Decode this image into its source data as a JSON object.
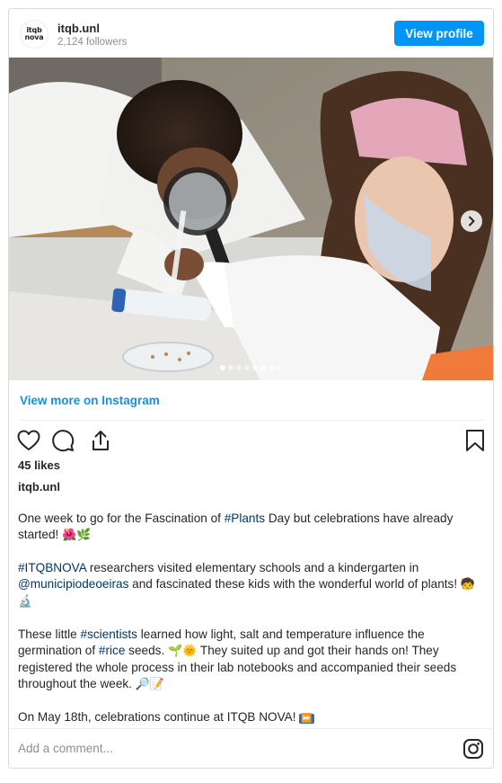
{
  "header": {
    "avatar_text_top": "itqb",
    "avatar_text_bottom": "nova",
    "username": "itqb.unl",
    "followers": "2,124 followers",
    "view_profile_label": "View profile"
  },
  "carousel": {
    "slide_count": 8,
    "active_index": 0
  },
  "view_more_label": "View more on Instagram",
  "likes": "45 likes",
  "caption_user": "itqb.unl",
  "caption": {
    "p1_a": "One week to go for the Fascination of ",
    "p1_tag": "#Plants",
    "p1_b": " Day but celebrations have already started! ",
    "p1_emoji": "🌺🌿",
    "p2_tag1": "#ITQBNOVA",
    "p2_a": " researchers visited elementary schools and a kindergarten in ",
    "p2_tag2": "@municipiodeoeiras",
    "p2_b": " and fascinated these kids with the wonderful world of plants! ",
    "p2_emoji": "🧒🔬",
    "p3_a": "These little ",
    "p3_tag1": "#scientists",
    "p3_b": " learned how light, salt and temperature influence the germination of ",
    "p3_tag2": "#rice",
    "p3_c": " seeds. ",
    "p3_emoji1": "🌱🌞",
    "p3_d": " They suited up and got their hands on! They registered the whole process in their lab notebooks and accompanied their seeds throughout the week. ",
    "p3_emoji2": "🔎📝",
    "p4_a": "On May 18th, celebrations continue at ITQB NOVA! ",
    "p4_emoji": "⏩"
  },
  "comment": {
    "placeholder": "Add a comment..."
  },
  "colors": {
    "accent": "#0095f6",
    "link": "#00376b",
    "muted": "#8e8e8e"
  },
  "icons": [
    "heart-icon",
    "comment-icon",
    "share-icon",
    "bookmark-icon",
    "instagram-icon",
    "chevron-right-icon"
  ]
}
